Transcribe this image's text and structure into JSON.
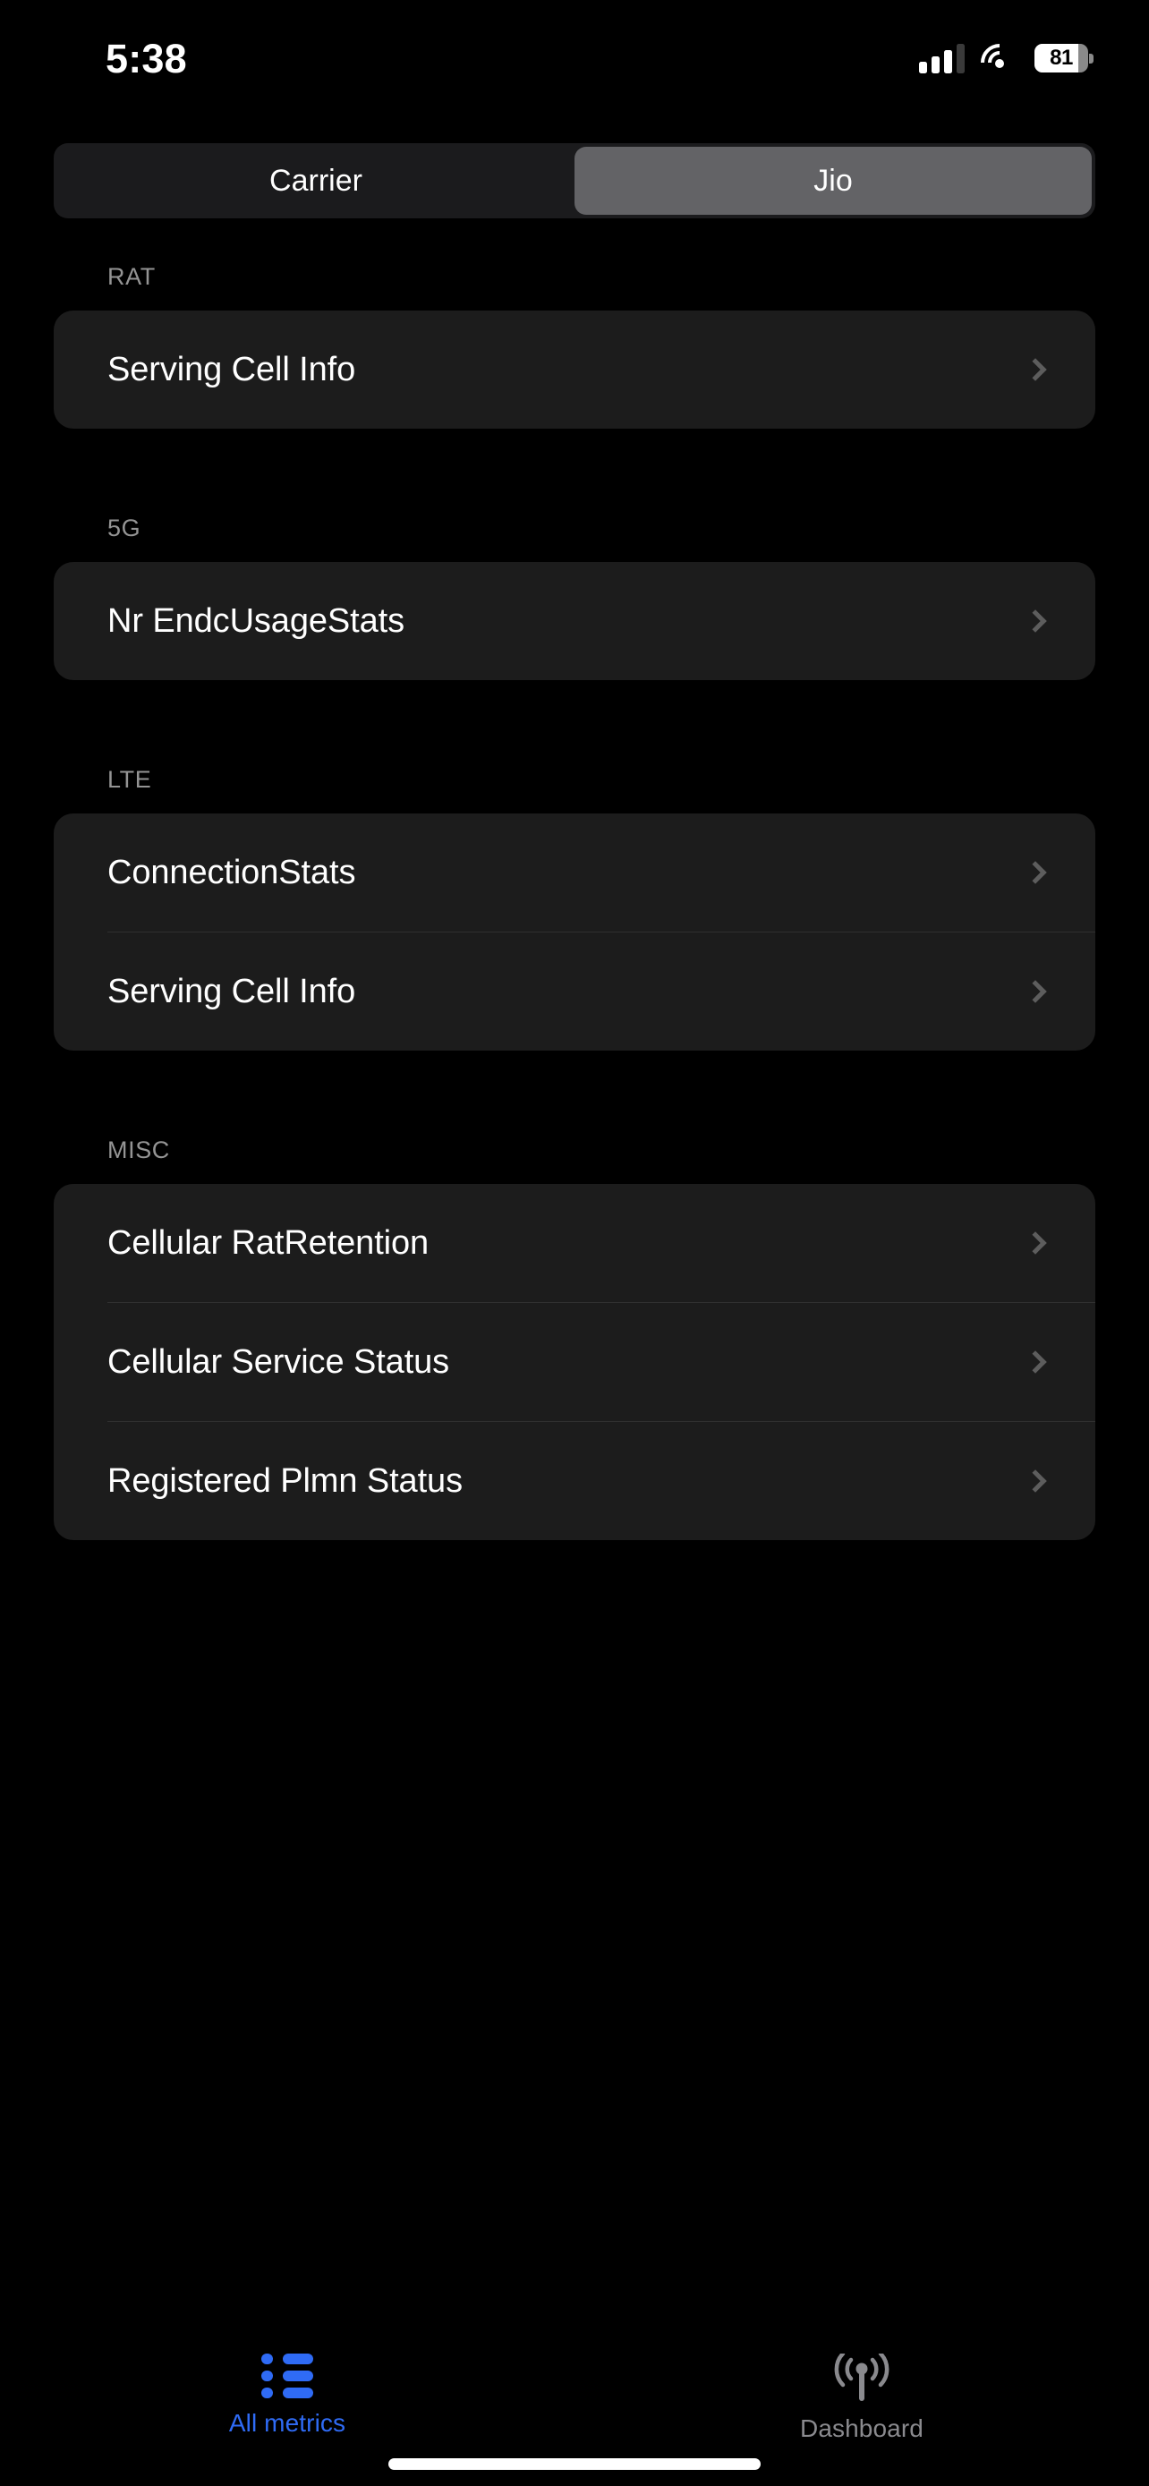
{
  "statusbar": {
    "time": "5:38",
    "battery_percent": "81",
    "battery_level": 81,
    "signal_icon": "cellular-signal-icon",
    "signal_bars_total": 4,
    "signal_bars_active": 3,
    "wifi_icon": "wifi-icon",
    "battery_icon": "battery-icon"
  },
  "segmented_control": {
    "options": [
      "Carrier",
      "Jio"
    ],
    "selected": "Jio",
    "selected_index": 1,
    "selected_bg": "#636366",
    "track_bg": "#1b1b1d"
  },
  "sections": [
    {
      "header": "RAT",
      "rows": [
        {
          "label": "Serving Cell Info",
          "accessory": "chevron-right-icon"
        }
      ]
    },
    {
      "header": "5G",
      "rows": [
        {
          "label": "Nr EndcUsageStats",
          "accessory": "chevron-right-icon"
        }
      ]
    },
    {
      "header": "LTE",
      "rows": [
        {
          "label": "ConnectionStats",
          "accessory": "chevron-right-icon"
        },
        {
          "label": "Serving Cell Info",
          "accessory": "chevron-right-icon"
        }
      ]
    },
    {
      "header": "MISC",
      "rows": [
        {
          "label": "Cellular RatRetention",
          "accessory": "chevron-right-icon"
        },
        {
          "label": "Cellular Service Status",
          "accessory": "chevron-right-icon"
        },
        {
          "label": "Registered Plmn Status",
          "accessory": "chevron-right-icon"
        }
      ]
    }
  ],
  "tabbar": {
    "tabs": [
      {
        "label": "All metrics",
        "icon": "list-bullet-icon",
        "active": true
      },
      {
        "label": "Dashboard",
        "icon": "antenna-signal-icon",
        "active": false
      }
    ],
    "active_color": "#2f6bf5",
    "inactive_color": "#8a8a8e"
  },
  "colors": {
    "background": "#000000",
    "card": "#1c1c1c",
    "divider": "#303030",
    "section_header": "#949494",
    "chevron": "#5d5d5d",
    "primary_text": "#ffffff"
  }
}
